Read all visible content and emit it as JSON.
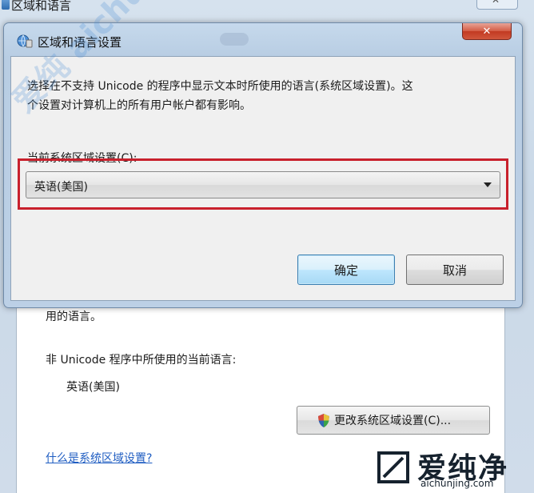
{
  "parent_window": {
    "title": "区域和语言",
    "fragment_text": "用的语言。",
    "non_unicode_label": "非 Unicode 程序中所使用的当前语言:",
    "current_language": "英语(美国)",
    "change_button_label": "更改系统区域设置(C)...",
    "help_link": "什么是系统区域设置?"
  },
  "dialog": {
    "title": "区域和语言设置",
    "description_line1": "选择在不支持 Unicode 的程序中显示文本时所使用的语言(系统区域设置)。这",
    "description_line2": "个设置对计算机上的所有用户帐户都有影响。",
    "locale_label": "当前系统区域设置(C):",
    "locale_selected": "英语(美国)",
    "ok_button": "确定",
    "cancel_button": "取消"
  },
  "watermark": {
    "diagonal_text": "爱纯 aichunjing.com",
    "brand": "爱纯净",
    "url": "aichunjing.com"
  },
  "colors": {
    "highlight_box": "#c8202c",
    "close_button": "#c23a22",
    "link": "#1f5dc2"
  }
}
